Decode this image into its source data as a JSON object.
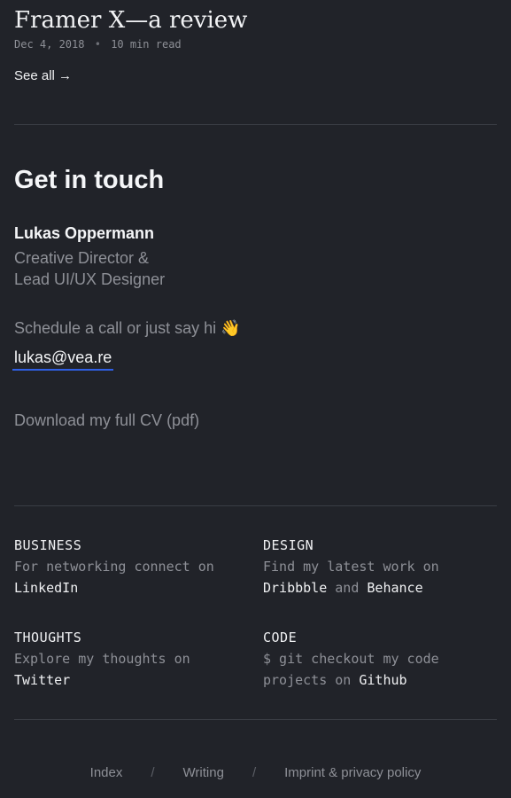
{
  "latest_post": {
    "title": "Framer X—a review",
    "date": "Dec 4, 2018",
    "separator": "•",
    "read_time": "10 min read",
    "see_all": "See all →"
  },
  "contact": {
    "heading": "Get in touch",
    "name": "Lukas Oppermann",
    "role_line1": "Creative Director &",
    "role_line2": "Lead UI/UX Designer",
    "schedule_text": "Schedule a call or just say hi 👋",
    "email": "lukas@vea.re",
    "cv_link": "Download my full CV (pdf)"
  },
  "links": {
    "business": {
      "heading": "BUSINESS",
      "text": "For networking connect on",
      "link": "LinkedIn"
    },
    "design": {
      "heading": "DESIGN",
      "text": "Find my latest work on",
      "link1": "Dribbble",
      "joiner": "and",
      "link2": "Behance"
    },
    "thoughts": {
      "heading": "THOUGHTS",
      "text": "Explore my thoughts on",
      "link": "Twitter"
    },
    "code": {
      "heading": "CODE",
      "text_line1": "$ git checkout my code",
      "text_line2": "projects on",
      "link": "Github"
    }
  },
  "footer": {
    "items": [
      "Index",
      "Writing",
      "Imprint & privacy policy"
    ],
    "separator": "/"
  },
  "colors": {
    "background": "#212329",
    "text": "#f2f3f5",
    "muted": "#8e9097",
    "accent_underline": "#2f5fe6",
    "rule": "#3a3d44"
  }
}
